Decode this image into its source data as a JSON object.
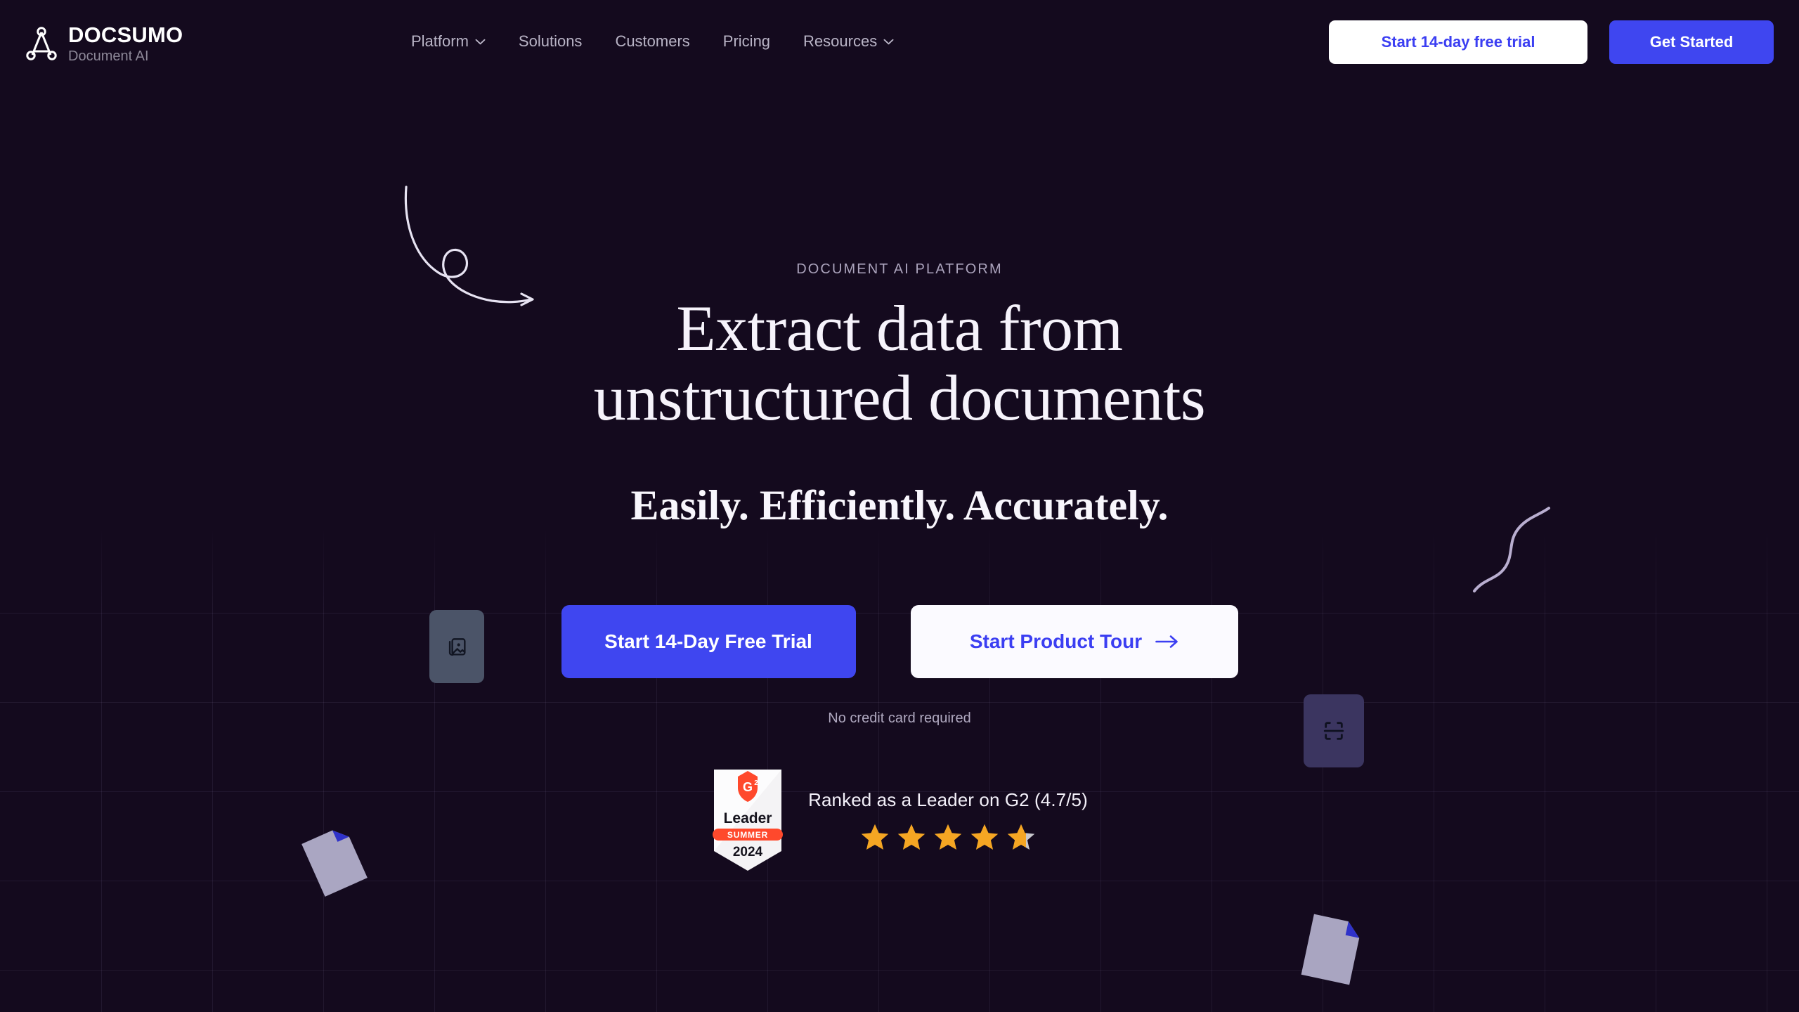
{
  "theme": {
    "bg": "#140a1e",
    "accent_blue": "#3f46f0",
    "accent_blue_text": "#3b3ef2",
    "text_primary": "#f6f3fb",
    "text_muted": "#b9b4c6",
    "star_gold": "#f5a623",
    "g2_red": "#ff492c"
  },
  "header": {
    "logo": {
      "icon": "network-node-icon",
      "name": "DOCSUMO",
      "tagline": "Document AI"
    },
    "nav": [
      {
        "label": "Platform",
        "has_dropdown": true,
        "icon": "chevron-down-icon"
      },
      {
        "label": "Solutions",
        "has_dropdown": false,
        "icon": ""
      },
      {
        "label": "Customers",
        "has_dropdown": false,
        "icon": ""
      },
      {
        "label": "Pricing",
        "has_dropdown": false,
        "icon": ""
      },
      {
        "label": "Resources",
        "has_dropdown": true,
        "icon": "chevron-down-icon"
      }
    ],
    "actions": {
      "trial_label": "Start 14-day free trial",
      "get_started_label": "Get Started"
    }
  },
  "hero": {
    "eyebrow": "DOCUMENT AI PLATFORM",
    "headline_line1": "Extract data from",
    "headline_line2": "unstructured documents",
    "subheadline": "Easily. Efficiently. Accurately.",
    "cta_primary": "Start 14-Day Free Trial",
    "cta_secondary": "Start Product Tour",
    "cta_secondary_icon": "arrow-right-icon",
    "disclaimer": "No credit card required"
  },
  "rating": {
    "badge": {
      "logo_text": "G",
      "logo_sup": "2",
      "title": "Leader",
      "season": "SUMMER",
      "year": "2024"
    },
    "text": "Ranked as a Leader on G2 (4.7/5)",
    "score": 4.7,
    "max": 5,
    "stars_filled": 4,
    "partial_star_fraction": 0.7
  },
  "decorations": {
    "arrow": "curly-arrow-icon",
    "squiggle": "wave-line-icon",
    "card_image_icon": "image-stack-icon",
    "card_scan_icon": "document-scan-icon",
    "doc_a_icon": "page-folded-corner-icon",
    "doc_b_icon": "page-folded-corner-icon"
  }
}
